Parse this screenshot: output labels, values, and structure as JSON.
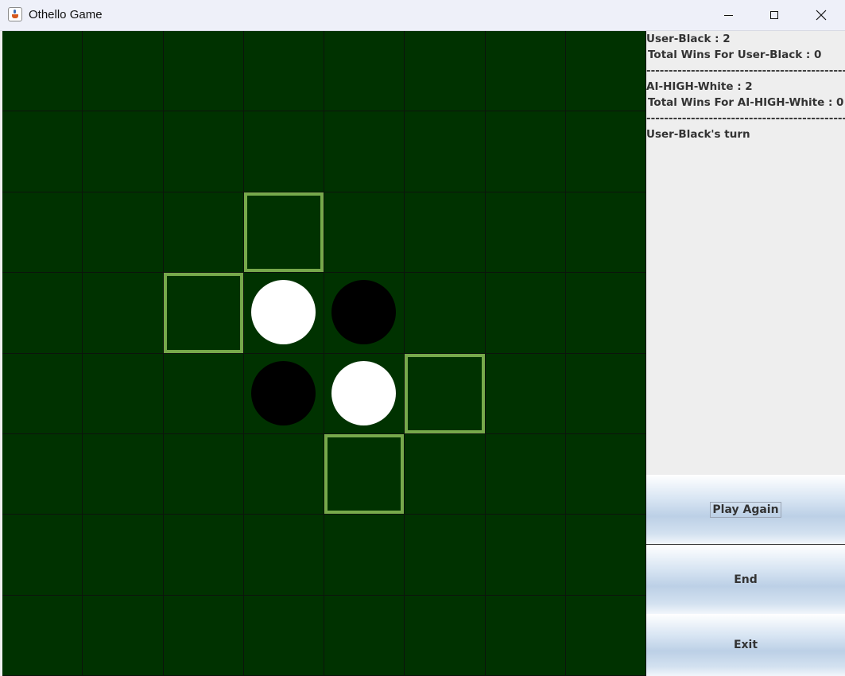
{
  "window": {
    "title": "Othello Game",
    "controls": [
      "minimize",
      "maximize",
      "close"
    ]
  },
  "board": {
    "size": 8,
    "colors": {
      "background": "#003200",
      "hint": "#77a94b",
      "grid": "#0c140c"
    },
    "discs": [
      {
        "row": 3,
        "col": 3,
        "color": "white"
      },
      {
        "row": 3,
        "col": 4,
        "color": "black"
      },
      {
        "row": 4,
        "col": 3,
        "color": "black"
      },
      {
        "row": 4,
        "col": 4,
        "color": "white"
      }
    ],
    "valid_moves": [
      {
        "row": 2,
        "col": 3
      },
      {
        "row": 3,
        "col": 2
      },
      {
        "row": 4,
        "col": 5
      },
      {
        "row": 5,
        "col": 4
      }
    ]
  },
  "status": {
    "black_score": "User-Black : 2",
    "black_wins": "Total Wins For User-Black : 0",
    "separator": "-----------------------------------------------",
    "white_score": "AI-HIGH-White : 2",
    "white_wins": "Total Wins For AI-HIGH-White : 0",
    "turn": "User-Black's turn"
  },
  "buttons": {
    "play_again": "Play Again",
    "end": "End",
    "exit": "Exit"
  }
}
